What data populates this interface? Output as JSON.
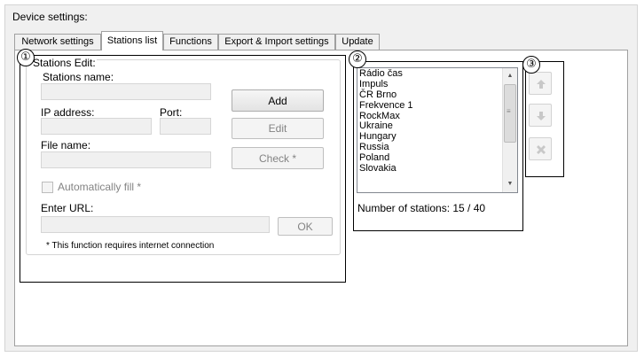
{
  "group_title": "Device settings:",
  "tabs": [
    {
      "label": "Network settings"
    },
    {
      "label": "Stations list"
    },
    {
      "label": "Functions"
    },
    {
      "label": "Export & Import settings"
    },
    {
      "label": "Update"
    }
  ],
  "active_tab": "Stations list",
  "callouts": [
    "①",
    "②",
    "③"
  ],
  "edit": {
    "group_title": "Stations Edit:",
    "station_name_label": "Stations name:",
    "station_name_value": "",
    "ip_label": "IP address:",
    "ip_value": "",
    "port_label": "Port:",
    "port_value": "",
    "file_label": "File name:",
    "file_value": "",
    "add_button": "Add",
    "edit_button": "Edit",
    "check_button": "Check *",
    "autofill_label": "Automatically fill *",
    "url_label": "Enter URL:",
    "url_value": "",
    "ok_button": "OK",
    "note": "* This function requires internet connection"
  },
  "stations": {
    "items": [
      "Rádio čas",
      "Impuls",
      "ČR Brno",
      "Frekvence 1",
      "RockMax",
      "Ukraine",
      "Hungary",
      "Russia",
      "Poland",
      "Slovakia"
    ],
    "count_text": "Number of stations: 15 / 40"
  },
  "side_buttons": {
    "up_icon": "arrow-up-icon",
    "down_icon": "arrow-down-icon",
    "delete_icon": "delete-x-icon"
  }
}
